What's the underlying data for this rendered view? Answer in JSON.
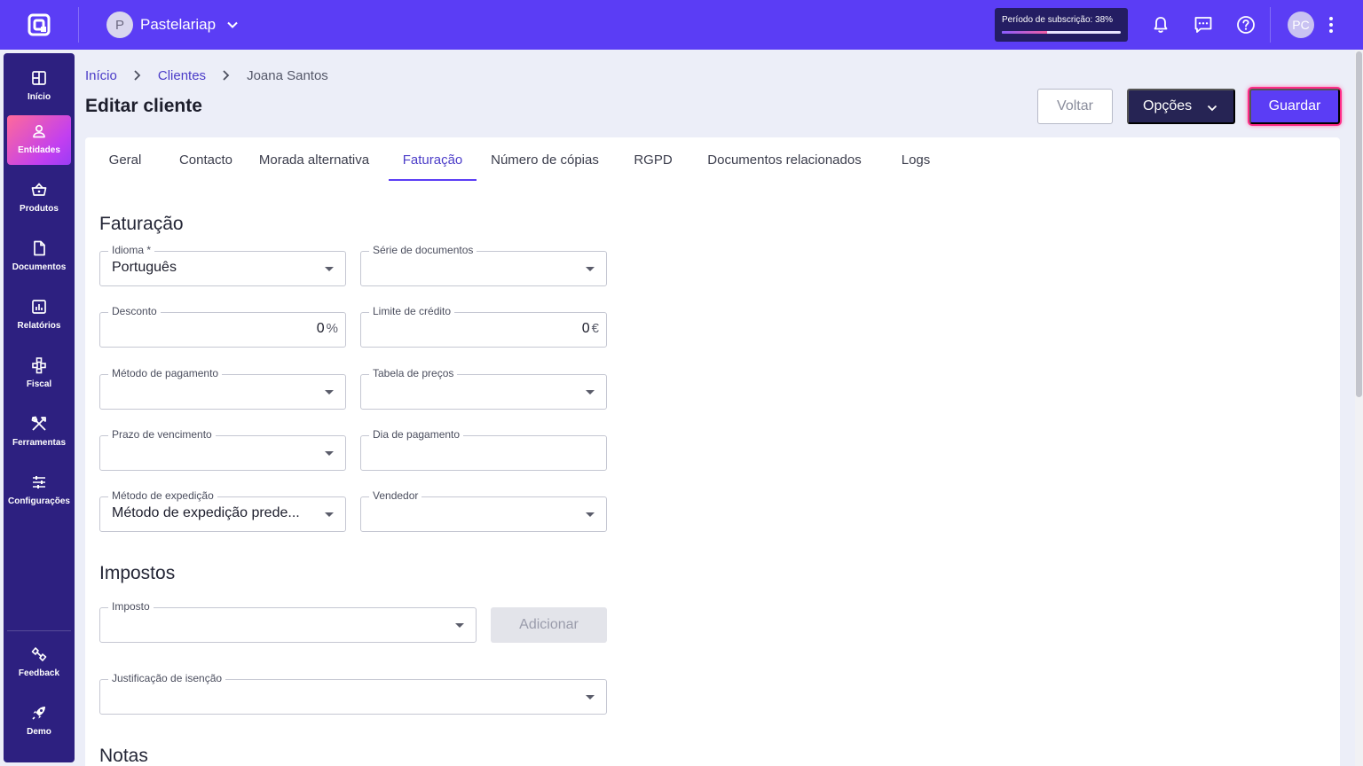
{
  "topbar": {
    "company_initial": "P",
    "company_name": "Pastelariap",
    "subscription_label": "Período de subscrição: 38%",
    "subscription_progress": 38,
    "user_initials": "PC",
    "icons": [
      "bell-icon",
      "chat-icon",
      "help-icon",
      "more-vertical-icon"
    ]
  },
  "sidebar": {
    "items": [
      {
        "label": "Início",
        "icon": "dashboard-icon"
      },
      {
        "label": "Entidades",
        "icon": "person-icon",
        "active": true
      },
      {
        "label": "Produtos",
        "icon": "basket-icon"
      },
      {
        "label": "Documentos",
        "icon": "document-icon"
      },
      {
        "label": "Relatórios",
        "icon": "report-icon"
      },
      {
        "label": "Fiscal",
        "icon": "fiscal-icon"
      },
      {
        "label": "Ferramentas",
        "icon": "tools-icon"
      },
      {
        "label": "Configurações",
        "icon": "sliders-icon"
      }
    ],
    "bottom_items": [
      {
        "label": "Feedback",
        "icon": "feedback-icon"
      },
      {
        "label": "Demo",
        "icon": "rocket-icon"
      }
    ]
  },
  "breadcrumb": {
    "home": "Início",
    "clients": "Clientes",
    "current": "Joana Santos"
  },
  "page_title": "Editar cliente",
  "actions": {
    "back": "Voltar",
    "options": "Opções",
    "save": "Guardar"
  },
  "tabs": [
    {
      "label": "Geral"
    },
    {
      "label": "Contacto"
    },
    {
      "label": "Morada alternativa"
    },
    {
      "label": "Faturação",
      "active": true
    },
    {
      "label": "Número de cópias"
    },
    {
      "label": "RGPD"
    },
    {
      "label": "Documentos relacionados"
    },
    {
      "label": "Logs"
    }
  ],
  "billing": {
    "title": "Faturação",
    "language": {
      "label": "Idioma *",
      "value": "Português"
    },
    "doc_series": {
      "label": "Série de documentos",
      "value": ""
    },
    "discount": {
      "label": "Desconto",
      "value": "0",
      "unit": "%"
    },
    "credit_limit": {
      "label": "Limite de crédito",
      "value": "0",
      "unit": "€"
    },
    "payment_method": {
      "label": "Método de pagamento",
      "value": ""
    },
    "price_table": {
      "label": "Tabela de preços",
      "value": ""
    },
    "due_term": {
      "label": "Prazo de vencimento",
      "value": ""
    },
    "payment_day": {
      "label": "Dia de pagamento",
      "value": ""
    },
    "shipping_method": {
      "label": "Método de expedição",
      "value": "Método de expedição prede..."
    },
    "seller": {
      "label": "Vendedor",
      "value": ""
    }
  },
  "taxes": {
    "title": "Impostos",
    "tax": {
      "label": "Imposto",
      "value": ""
    },
    "add_button": "Adicionar",
    "exemption": {
      "label": "Justificação de isenção",
      "value": ""
    }
  },
  "notes": {
    "title": "Notas"
  }
}
